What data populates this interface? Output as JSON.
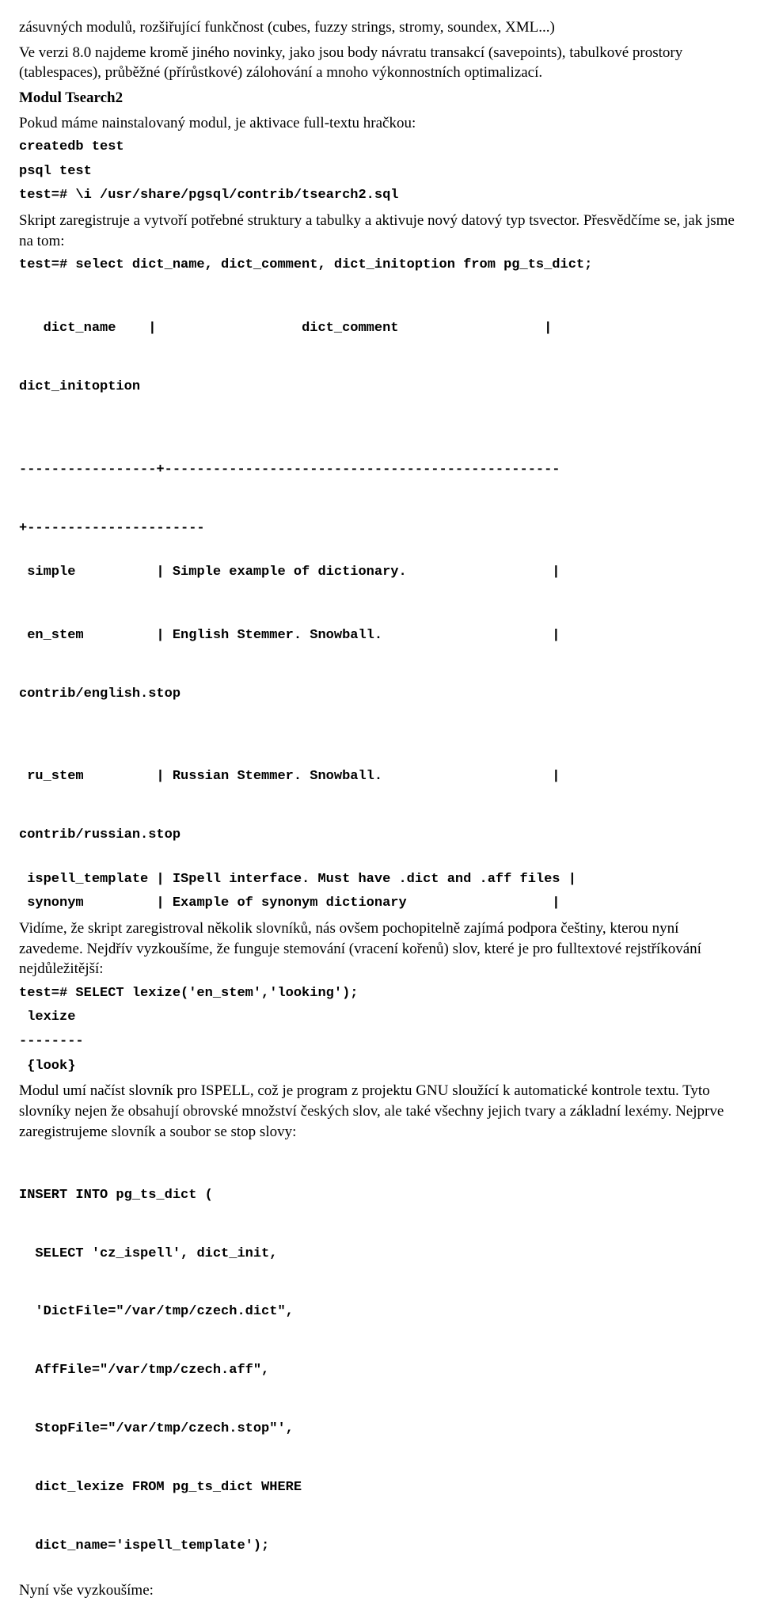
{
  "p1": "zásuvných modulů, rozšiřující funkčnost (cubes, fuzzy strings, stromy, soundex, XML...)",
  "p2": "Ve verzi 8.0 najdeme kromě jiného novinky, jako jsou body návratu transakcí (savepoints), tabulkové prostory (tablespaces), průběžné (přírůstkové) zálohování a mnoho výkonnostních optimalizací.",
  "h1": "Modul Tsearch2",
  "p3": "Pokud máme nainstalovaný modul, je aktivace full-textu hračkou:",
  "c1": "createdb test",
  "c2": "psql test",
  "c3": "test=# \\i /usr/share/pgsql/contrib/tsearch2.sql",
  "p4": "Skript zaregistruje a vytvoří potřebné struktury a tabulky a aktivuje nový datový typ tsvector. Přesvědčíme se, jak jsme na tom:",
  "c4": "test=# select dict_name, dict_comment, dict_initoption from pg_ts_dict;",
  "c5a": "   dict_name    |                  dict_comment                  | ",
  "c5b": "dict_initoption",
  "c6a": "-----------------+-------------------------------------------------",
  "c6b": "+----------------------",
  "c7": " simple          | Simple example of dictionary.                  |",
  "c8": " en_stem         | English Stemmer. Snowball.                     | ",
  "c8b": "contrib/english.stop",
  "c9": " ru_stem         | Russian Stemmer. Snowball.                     | ",
  "c9b": "contrib/russian.stop",
  "c10": " ispell_template | ISpell interface. Must have .dict and .aff files |",
  "c11": " synonym         | Example of synonym dictionary                  |",
  "p5": "Vidíme, že skript zaregistroval několik slovníků, nás ovšem pochopitelně zajímá podpora češtiny, kterou nyní zavedeme. Nejdřív vyzkoušíme, že funguje stemování (vracení kořenů) slov, které je pro fulltextové rejstříkování nejdůležitější:",
  "c12": "test=# SELECT lexize('en_stem','looking');",
  "c13": " lexize",
  "c14": "--------",
  "c15": " {look}",
  "p6": "Modul umí načíst slovník pro ISPELL, což je program z projektu GNU sloužící k automatické kontrole textu. Tyto slovníky nejen že obsahují obrovské množství českých slov, ale také všechny jejich tvary a základní lexémy. Nejprve zaregistrujeme slovník a soubor se stop slovy:",
  "c16a": "INSERT INTO pg_ts_dict (",
  "c16b": "  SELECT 'cz_ispell', dict_init,",
  "c16c": "  'DictFile=\"/var/tmp/czech.dict\",",
  "c16d": "  AffFile=\"/var/tmp/czech.aff\",",
  "c16e": "  StopFile=\"/var/tmp/czech.stop\"',",
  "c16f": "  dict_lexize FROM pg_ts_dict WHERE",
  "c16g": "  dict_name='ispell_template');",
  "p7": "Nyní vše vyzkoušíme:"
}
